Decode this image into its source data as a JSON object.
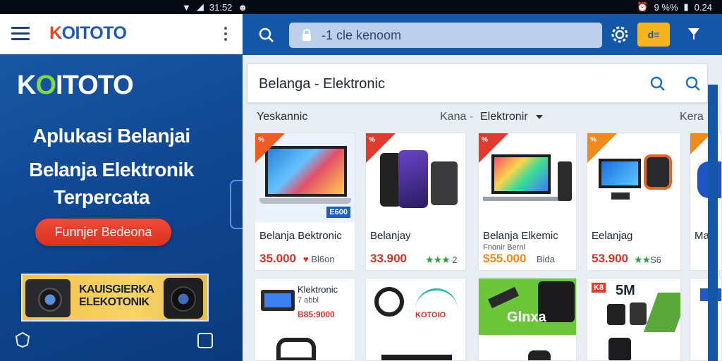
{
  "status_bar": {
    "time": "31:52",
    "battery_text": "9 %%",
    "clock_right": "0.24"
  },
  "left": {
    "app_logo": {
      "k": "K",
      "rest": "OITOTO"
    },
    "brand": {
      "pre": "K",
      "o": "O",
      "rest": "ITOTO"
    },
    "headline1": "Aplukasi Belanjai",
    "headline2": "Belanja Elektronik",
    "headline3": "Terpercata",
    "cta_label": "Funnjer Bedeona",
    "banner_text": "KAUISGIERKA\nELEKOTONIK"
  },
  "right": {
    "url_text": "-1 cle kenoom",
    "badge_text": "d≡",
    "search_value": "Belanga - Elektronic",
    "filter": {
      "left": "Yeskannic",
      "kana": "Kana",
      "sep": "-",
      "category": "Elektronir",
      "right": "Kera"
    },
    "products": [
      {
        "title": "Belanja Bektronic",
        "price": "35.000",
        "extra": "Bl6on",
        "ribbon": "%",
        "badge": "E600"
      },
      {
        "title": "Belanjay",
        "price": "33.900",
        "extra": "2",
        "ribbon": "%"
      },
      {
        "title": "Belanja Elkemic",
        "subtitle": "Fnonir Bernl",
        "price": "$55.000",
        "extra": "Bida",
        "ribbon": "%"
      },
      {
        "title": "Eelanjag",
        "price": "53.900",
        "extra": "S6",
        "ribbon": "%"
      },
      {
        "title": "Mat"
      },
      {
        "title": "Klektronic",
        "subtitle": "7 abbl",
        "price": "B85:9000"
      },
      {
        "title": "KOTOIO"
      },
      {
        "title": "Glnxa"
      },
      {
        "title": "5M",
        "badge": "K8"
      }
    ]
  },
  "colors": {
    "brand_blue": "#1456a8",
    "accent_red": "#d8332a",
    "accent_yellow": "#f6b51e"
  }
}
